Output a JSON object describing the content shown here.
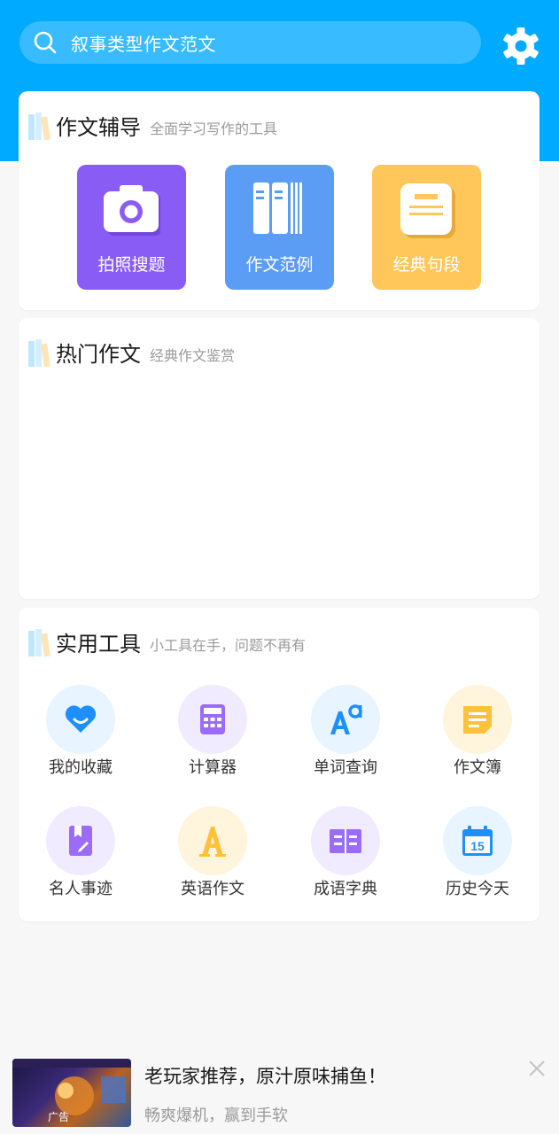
{
  "search": {
    "placeholder": "叙事类型作文范文"
  },
  "guidance": {
    "title": "作文辅导",
    "subtitle": "全面学习写作的工具",
    "tiles": [
      {
        "label": "拍照搜题",
        "icon": "camera-icon",
        "color": "#8a5cf6"
      },
      {
        "label": "作文范例",
        "icon": "books-icon",
        "color": "#5b9cf5"
      },
      {
        "label": "经典句段",
        "icon": "note-icon",
        "color": "#ffc75a"
      }
    ]
  },
  "hot": {
    "title": "热门作文",
    "subtitle": "经典作文鉴赏"
  },
  "tools": {
    "title": "实用工具",
    "subtitle": "小工具在手，问题不再有",
    "items": [
      {
        "label": "我的收藏",
        "icon": "heart-icon",
        "color": "#1e8fff",
        "bg": "#e8f4ff"
      },
      {
        "label": "计算器",
        "icon": "calculator-icon",
        "color": "#9b6cf5",
        "bg": "#f1ebff"
      },
      {
        "label": "单词查询",
        "icon": "font-size-icon",
        "color": "#1e8fff",
        "bg": "#e8f4ff"
      },
      {
        "label": "作文簿",
        "icon": "notebook-icon",
        "color": "#ffc13a",
        "bg": "#fff4dc"
      },
      {
        "label": "名人事迹",
        "icon": "bookmark-pen-icon",
        "color": "#9b6cf5",
        "bg": "#f1ebff"
      },
      {
        "label": "英语作文",
        "icon": "letter-a-icon",
        "color": "#ffc13a",
        "bg": "#fff4dc"
      },
      {
        "label": "成语字典",
        "icon": "open-book-icon",
        "color": "#9b6cf5",
        "bg": "#f1ebff"
      },
      {
        "label": "历史今天",
        "icon": "calendar-icon",
        "color": "#1e8fff",
        "bg": "#e8f4ff"
      }
    ],
    "calendar_day": "15"
  },
  "ad": {
    "title": "老玩家推荐，原汁原味捕鱼！",
    "description": "畅爽爆机，赢到手软",
    "badge": "广告"
  },
  "colors": {
    "header": "#00aaff",
    "background": "#f7f7f7"
  }
}
